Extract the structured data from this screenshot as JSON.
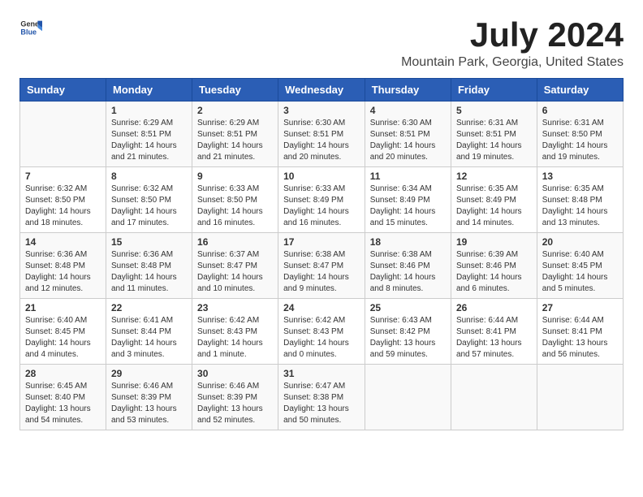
{
  "logo": {
    "text_general": "General",
    "text_blue": "Blue"
  },
  "title": "July 2024",
  "subtitle": "Mountain Park, Georgia, United States",
  "days_of_week": [
    "Sunday",
    "Monday",
    "Tuesday",
    "Wednesday",
    "Thursday",
    "Friday",
    "Saturday"
  ],
  "weeks": [
    [
      {
        "day": "",
        "info": ""
      },
      {
        "day": "1",
        "info": "Sunrise: 6:29 AM\nSunset: 8:51 PM\nDaylight: 14 hours\nand 21 minutes."
      },
      {
        "day": "2",
        "info": "Sunrise: 6:29 AM\nSunset: 8:51 PM\nDaylight: 14 hours\nand 21 minutes."
      },
      {
        "day": "3",
        "info": "Sunrise: 6:30 AM\nSunset: 8:51 PM\nDaylight: 14 hours\nand 20 minutes."
      },
      {
        "day": "4",
        "info": "Sunrise: 6:30 AM\nSunset: 8:51 PM\nDaylight: 14 hours\nand 20 minutes."
      },
      {
        "day": "5",
        "info": "Sunrise: 6:31 AM\nSunset: 8:51 PM\nDaylight: 14 hours\nand 19 minutes."
      },
      {
        "day": "6",
        "info": "Sunrise: 6:31 AM\nSunset: 8:50 PM\nDaylight: 14 hours\nand 19 minutes."
      }
    ],
    [
      {
        "day": "7",
        "info": "Sunrise: 6:32 AM\nSunset: 8:50 PM\nDaylight: 14 hours\nand 18 minutes."
      },
      {
        "day": "8",
        "info": "Sunrise: 6:32 AM\nSunset: 8:50 PM\nDaylight: 14 hours\nand 17 minutes."
      },
      {
        "day": "9",
        "info": "Sunrise: 6:33 AM\nSunset: 8:50 PM\nDaylight: 14 hours\nand 16 minutes."
      },
      {
        "day": "10",
        "info": "Sunrise: 6:33 AM\nSunset: 8:49 PM\nDaylight: 14 hours\nand 16 minutes."
      },
      {
        "day": "11",
        "info": "Sunrise: 6:34 AM\nSunset: 8:49 PM\nDaylight: 14 hours\nand 15 minutes."
      },
      {
        "day": "12",
        "info": "Sunrise: 6:35 AM\nSunset: 8:49 PM\nDaylight: 14 hours\nand 14 minutes."
      },
      {
        "day": "13",
        "info": "Sunrise: 6:35 AM\nSunset: 8:48 PM\nDaylight: 14 hours\nand 13 minutes."
      }
    ],
    [
      {
        "day": "14",
        "info": "Sunrise: 6:36 AM\nSunset: 8:48 PM\nDaylight: 14 hours\nand 12 minutes."
      },
      {
        "day": "15",
        "info": "Sunrise: 6:36 AM\nSunset: 8:48 PM\nDaylight: 14 hours\nand 11 minutes."
      },
      {
        "day": "16",
        "info": "Sunrise: 6:37 AM\nSunset: 8:47 PM\nDaylight: 14 hours\nand 10 minutes."
      },
      {
        "day": "17",
        "info": "Sunrise: 6:38 AM\nSunset: 8:47 PM\nDaylight: 14 hours\nand 9 minutes."
      },
      {
        "day": "18",
        "info": "Sunrise: 6:38 AM\nSunset: 8:46 PM\nDaylight: 14 hours\nand 8 minutes."
      },
      {
        "day": "19",
        "info": "Sunrise: 6:39 AM\nSunset: 8:46 PM\nDaylight: 14 hours\nand 6 minutes."
      },
      {
        "day": "20",
        "info": "Sunrise: 6:40 AM\nSunset: 8:45 PM\nDaylight: 14 hours\nand 5 minutes."
      }
    ],
    [
      {
        "day": "21",
        "info": "Sunrise: 6:40 AM\nSunset: 8:45 PM\nDaylight: 14 hours\nand 4 minutes."
      },
      {
        "day": "22",
        "info": "Sunrise: 6:41 AM\nSunset: 8:44 PM\nDaylight: 14 hours\nand 3 minutes."
      },
      {
        "day": "23",
        "info": "Sunrise: 6:42 AM\nSunset: 8:43 PM\nDaylight: 14 hours\nand 1 minute."
      },
      {
        "day": "24",
        "info": "Sunrise: 6:42 AM\nSunset: 8:43 PM\nDaylight: 14 hours\nand 0 minutes."
      },
      {
        "day": "25",
        "info": "Sunrise: 6:43 AM\nSunset: 8:42 PM\nDaylight: 13 hours\nand 59 minutes."
      },
      {
        "day": "26",
        "info": "Sunrise: 6:44 AM\nSunset: 8:41 PM\nDaylight: 13 hours\nand 57 minutes."
      },
      {
        "day": "27",
        "info": "Sunrise: 6:44 AM\nSunset: 8:41 PM\nDaylight: 13 hours\nand 56 minutes."
      }
    ],
    [
      {
        "day": "28",
        "info": "Sunrise: 6:45 AM\nSunset: 8:40 PM\nDaylight: 13 hours\nand 54 minutes."
      },
      {
        "day": "29",
        "info": "Sunrise: 6:46 AM\nSunset: 8:39 PM\nDaylight: 13 hours\nand 53 minutes."
      },
      {
        "day": "30",
        "info": "Sunrise: 6:46 AM\nSunset: 8:39 PM\nDaylight: 13 hours\nand 52 minutes."
      },
      {
        "day": "31",
        "info": "Sunrise: 6:47 AM\nSunset: 8:38 PM\nDaylight: 13 hours\nand 50 minutes."
      },
      {
        "day": "",
        "info": ""
      },
      {
        "day": "",
        "info": ""
      },
      {
        "day": "",
        "info": ""
      }
    ]
  ]
}
